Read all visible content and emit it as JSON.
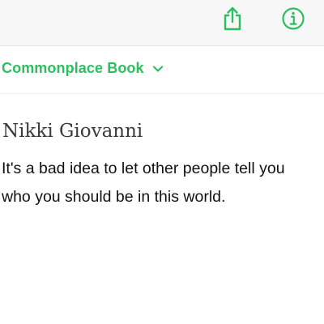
{
  "toolbar": {
    "share_icon": "share-icon",
    "info_icon": "info-icon"
  },
  "notebook": {
    "name": "Commonplace Book",
    "chevron_icon": "chevron-down-icon"
  },
  "note": {
    "title": "Nikki Giovanni",
    "body_lines": [
      "It's a bad idea to let other people tell you",
      "who you should be in this world."
    ]
  },
  "colors": {
    "accent": "#2dbe60",
    "toolbar_bg": "#f7f7f7",
    "title_text": "#3a3a3a",
    "body_text": "#111111"
  }
}
